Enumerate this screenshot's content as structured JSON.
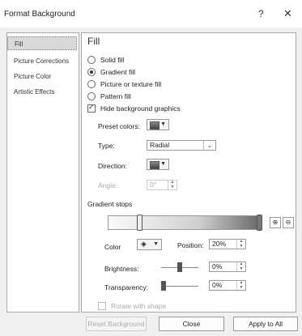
{
  "window": {
    "title": "Format Background",
    "help_label": "?",
    "close_label": "✕"
  },
  "sidebar": {
    "items": [
      {
        "label": "Fill"
      },
      {
        "label": "Picture Corrections"
      },
      {
        "label": "Picture Color"
      },
      {
        "label": "Artistic Effects"
      }
    ]
  },
  "fill": {
    "heading": "Fill",
    "solid": "Solid fill",
    "gradient": "Gradient fill",
    "picture": "Picture or texture fill",
    "pattern": "Pattern fill",
    "hide_bg": "Hide background graphics",
    "selected_option": "Gradient fill"
  },
  "preset": {
    "label": "Preset colors:"
  },
  "type": {
    "label": "Type:",
    "value": "Radial"
  },
  "direction": {
    "label": "Direction:"
  },
  "angle": {
    "label": "Angle:",
    "value": "0°"
  },
  "stops": {
    "label": "Gradient stops"
  },
  "color": {
    "label": "Color"
  },
  "position": {
    "label": "Position:",
    "value": "20%"
  },
  "brightness": {
    "label": "Brightness:",
    "value": "0%",
    "level": 0.5
  },
  "transparency": {
    "label": "Transparency:",
    "value": "0%",
    "level": 0
  },
  "rotate": {
    "label": "Rotate with shape"
  },
  "footer": {
    "reset": "Reset Background",
    "close": "Close",
    "apply_all": "Apply to All"
  }
}
